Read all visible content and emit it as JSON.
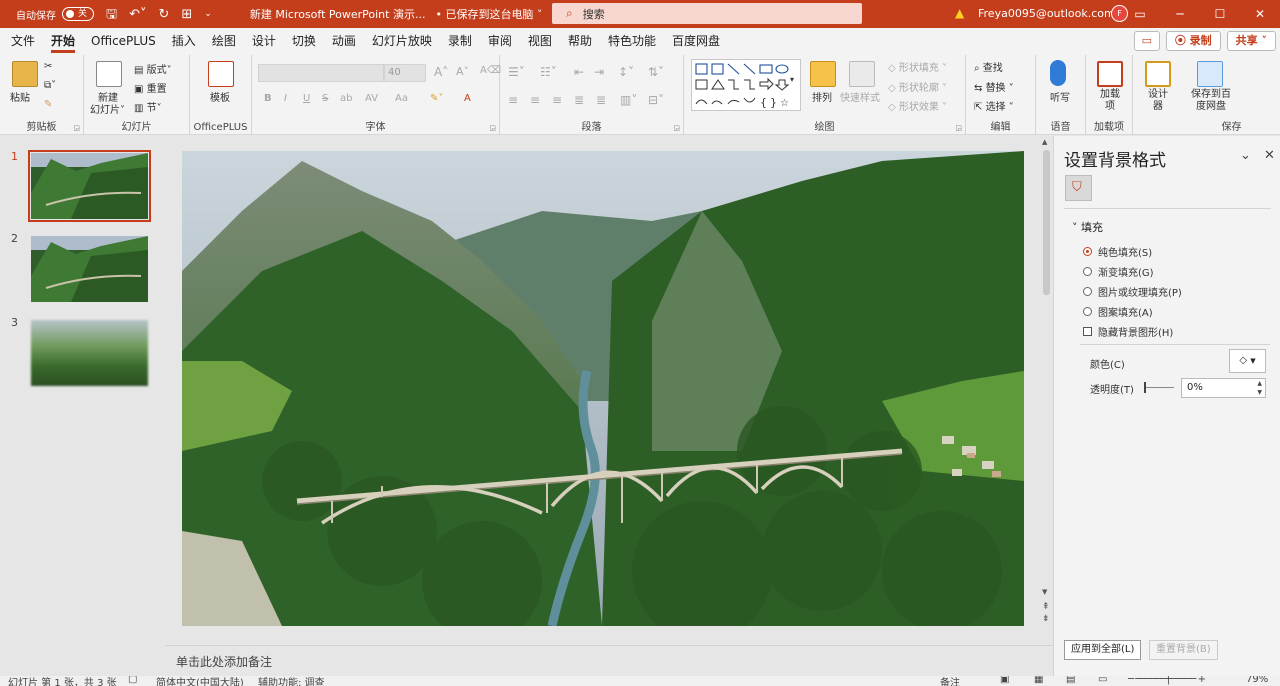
{
  "titlebar": {
    "autosave_label": "自动保存",
    "autosave_state": "关",
    "doc_title": "新建 Microsoft PowerPoint 演示...",
    "save_status": "• 已保存到这台电脑 ˅",
    "search_placeholder": "搜索",
    "account": "Freya0095@outlook.com",
    "window_buttons": [
      "▭",
      "─",
      "☐",
      "✕"
    ]
  },
  "tabs": [
    "文件",
    "开始",
    "OfficePLUS",
    "插入",
    "绘图",
    "设计",
    "切换",
    "动画",
    "幻灯片放映",
    "录制",
    "审阅",
    "视图",
    "帮助",
    "特色功能",
    "百度网盘"
  ],
  "active_tab": "开始",
  "tabs_right": {
    "record": "⦿ 录制",
    "share": "共享 ˅"
  },
  "ribbon": {
    "clipboard": {
      "paste": "粘贴",
      "label": "剪贴板"
    },
    "slides": {
      "new_slide": "新建",
      "new_slide2": "幻灯片˅",
      "layout": "版式˅",
      "reset": "重置",
      "section": "节˅",
      "label": "幻灯片"
    },
    "officeplus": {
      "template": "模板",
      "label": "OfficePLUS"
    },
    "font": {
      "size": "40",
      "buttons": [
        "B",
        "I",
        "U",
        "S",
        "ab",
        "AV",
        "Aa",
        "A",
        "A"
      ],
      "label": "字体"
    },
    "paragraph": {
      "label": "段落"
    },
    "drawing": {
      "arrange": "排列",
      "quick_styles": "快速样式",
      "shape_fill": "形状填充 ˅",
      "shape_outline": "形状轮廓 ˅",
      "shape_effects": "形状效果 ˅",
      "label": "绘图"
    },
    "editing": {
      "find": "查找",
      "replace": "替换 ˅",
      "select": "选择 ˅",
      "label": "编辑"
    },
    "voice": {
      "dictate": "听写",
      "label": "语音"
    },
    "addins": {
      "addins": "加载项",
      "label": "加载项"
    },
    "designer": {
      "designer": "设计器"
    },
    "save": {
      "save_to": "保存到百度网盘",
      "label": "保存"
    }
  },
  "slides": [
    {
      "num": "1",
      "active": true
    },
    {
      "num": "2",
      "active": false
    },
    {
      "num": "3",
      "active": false
    }
  ],
  "notes_placeholder": "单击此处添加备注",
  "pane": {
    "title": "设置背景格式",
    "section": "填充",
    "options": [
      {
        "label": "纯色填充(S)",
        "type": "radio",
        "checked": true
      },
      {
        "label": "渐变填充(G)",
        "type": "radio",
        "checked": false
      },
      {
        "label": "图片或纹理填充(P)",
        "type": "radio",
        "checked": false
      },
      {
        "label": "图案填充(A)",
        "type": "radio",
        "checked": false
      },
      {
        "label": "隐藏背景图形(H)",
        "type": "checkbox",
        "checked": false
      }
    ],
    "color_label": "颜色(C)",
    "transparency_label": "透明度(T)",
    "transparency_value": "0%",
    "apply_all": "应用到全部(L)",
    "reset": "重置背景(B)"
  },
  "status": {
    "slide_info": "幻灯片 第 1 张，共 3 张",
    "language": "简体中文(中国大陆)",
    "accessibility": "辅助功能: 调查",
    "notes_btn": "备注",
    "zoom": "79%"
  },
  "colors": {
    "accent": "#c43e1c",
    "titlebar": "#c43e1c",
    "search_bg": "#f7d7cf"
  }
}
